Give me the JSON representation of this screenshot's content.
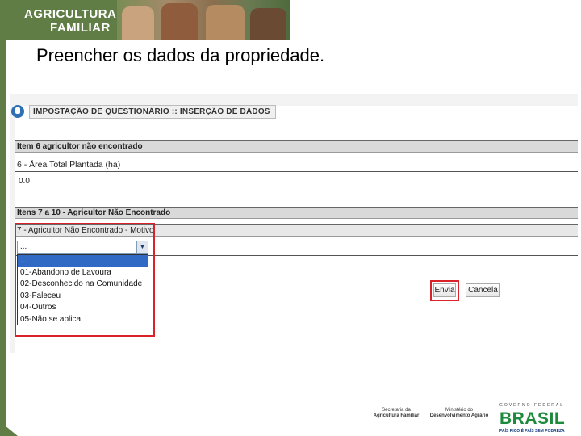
{
  "banner": {
    "logo_line1": "AGRICULTURA",
    "logo_line2": "FAMILIAR"
  },
  "slide_title": "Preencher os dados da propriedade.",
  "form": {
    "header": "IMPOSTAÇÃO DE QUESTIONÁRIO :: INSERÇÃO DE DADOS",
    "section1_title": "Item 6 agricultor não encontrado",
    "field6_label": "6 - Área Total Plantada (ha)",
    "field6_value": "0.0",
    "section2_title": "Itens 7 a 10 - Agricultor Não Encontrado",
    "field7_label": "7 - Agricultor Não Encontrado - Motivo",
    "field7_selected": "...",
    "field7_options": [
      "...",
      "01-Abandono de Lavoura",
      "02-Desconhecido na Comunidade",
      "03-Faleceu",
      "04-Outros",
      "05-Não se aplica"
    ],
    "send_button": "Envia",
    "cancel_button": "Cancela"
  },
  "footer": {
    "secretaria": "Secretaria da",
    "secretaria_name": "Agricultura Familiar",
    "ministerio": "Ministério do",
    "ministerio_name": "Desenvolvimento Agrário",
    "governo": "GOVERNO FEDERAL",
    "brasil": "BRASIL",
    "slogan": "PAÍS RICO É PAÍS SEM POBREZA"
  },
  "colors": {
    "brand_green": "#5f7d44",
    "highlight_red": "#d9222a",
    "selection_blue": "#316ac5"
  }
}
